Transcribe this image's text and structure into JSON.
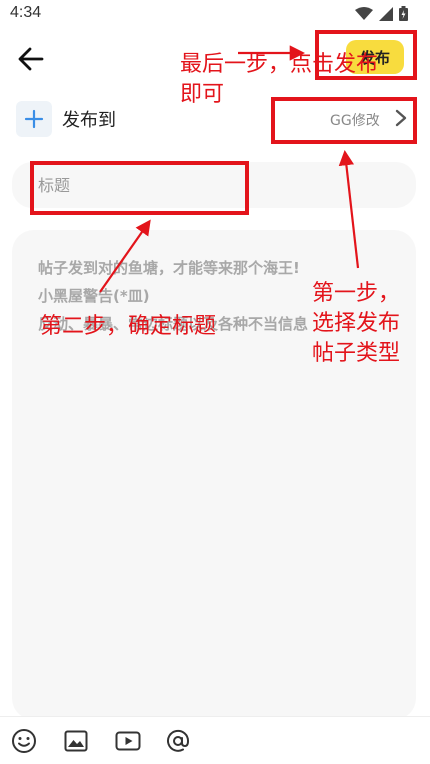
{
  "status_bar": {
    "time": "4:34",
    "icons": [
      "wifi-icon",
      "signal-icon",
      "battery-icon"
    ]
  },
  "top_bar": {
    "back_icon": "arrow-left-icon",
    "publish_label": "发布",
    "publish_color": "#f8dc3e"
  },
  "category": {
    "add_icon": "plus-icon",
    "label": "发布到",
    "value": "GG修改",
    "chevron_icon": "chevron-right-icon"
  },
  "title_field": {
    "placeholder": "标题"
  },
  "content": {
    "placeholder_lines": [
      "帖子发到对的鱼塘，才能等来那个海王!",
      "小黑屋警告(*皿)",
      "反动、暴暴、常边标题以及各种不当信息"
    ]
  },
  "toolbar": {
    "icons": [
      "emoji-icon",
      "image-icon",
      "video-icon",
      "at-icon"
    ]
  },
  "annotations": {
    "color": "#e3141b",
    "step_last": [
      "最后一步，点击发布",
      "即可"
    ],
    "step_one": [
      "第一步，",
      "选择发布",
      "帖子类型"
    ],
    "step_two": "第二步，确定标题"
  }
}
